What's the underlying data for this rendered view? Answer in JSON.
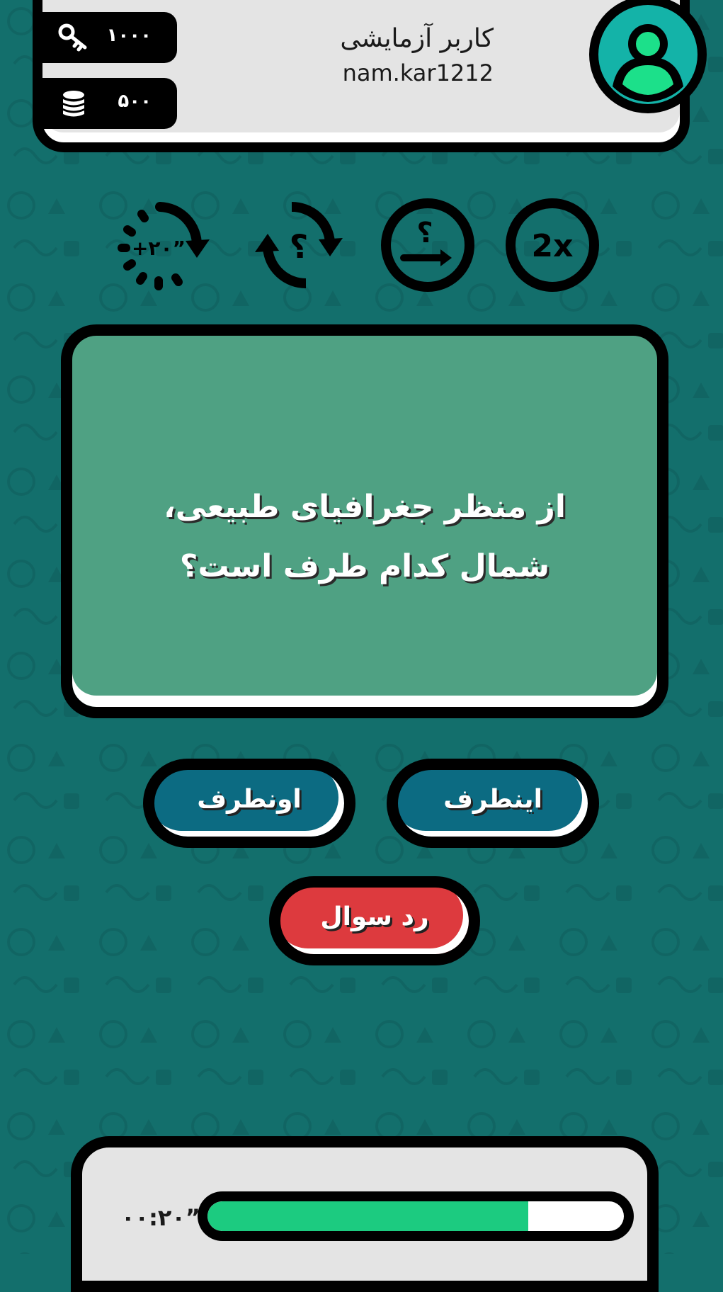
{
  "user": {
    "name": "کاربر آزمایشی",
    "handle": "nam.kar1212",
    "avatar_icon": "user-avatar-icon"
  },
  "stats": {
    "keys": {
      "icon": "key-icon",
      "value": "۱۰۰۰"
    },
    "coins": {
      "icon": "coins-icon",
      "value": "۵۰۰"
    }
  },
  "powerups": {
    "add_time": {
      "icon": "add-time-icon",
      "label": "+۲۰”"
    },
    "swap_question": {
      "icon": "swap-question-icon",
      "label": "؟"
    },
    "skip_question": {
      "icon": "skip-question-icon",
      "label": "؟"
    },
    "double": {
      "icon": "double-score-icon",
      "label": "2x"
    }
  },
  "question": {
    "line1": "از منظر جغرافیای طبیعی،",
    "line2": "شمال کدام طرف است؟"
  },
  "answers": {
    "left": "اونطرف",
    "right": "اینطرف"
  },
  "reject_label": "رد سوال",
  "timer": {
    "text": "۰۰:۲۰”",
    "progress": 0.77
  },
  "colors": {
    "background": "#136f6c",
    "card": "#e4e4e4",
    "question_card": "#4fa183",
    "answer_button": "#0c6b82",
    "reject_button": "#dd3a3e",
    "timer_fill": "#1ccb80",
    "avatar_ring": "#14b3a8",
    "avatar_person": "#1ce08a"
  }
}
